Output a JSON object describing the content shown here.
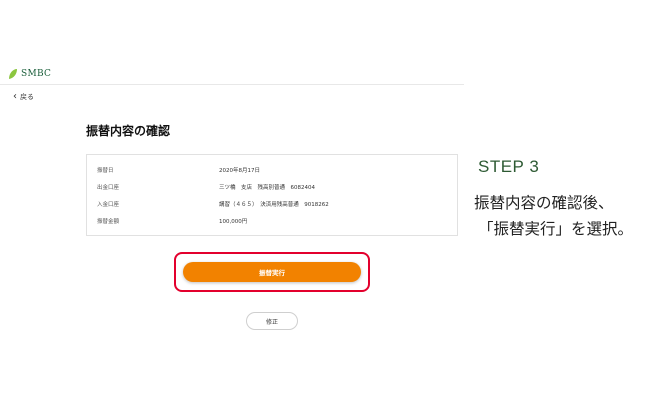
{
  "brand": {
    "name": "SMBC",
    "color": "#1a5e3a"
  },
  "nav": {
    "back_label": "戻る"
  },
  "page": {
    "title": "振替内容の確認"
  },
  "details": {
    "rows": [
      {
        "label": "振替日",
        "value": "2020年8月17日"
      },
      {
        "label": "出金口座",
        "value": "三ツ橋　支店　残高別普通　6082404"
      },
      {
        "label": "入金口座",
        "value": "講習（４６５）　決済用残高普通　9018262"
      },
      {
        "label": "振替金額",
        "value": "100,000円"
      }
    ]
  },
  "actions": {
    "execute_label": "振替実行",
    "fix_label": "修正",
    "execute_color": "#f28200",
    "highlight_color": "#e3002d"
  },
  "instruction": {
    "step": "STEP 3",
    "line1": "振替内容の確認後、",
    "line2": "「振替実行」を選択。",
    "step_color": "#2d5a33"
  }
}
